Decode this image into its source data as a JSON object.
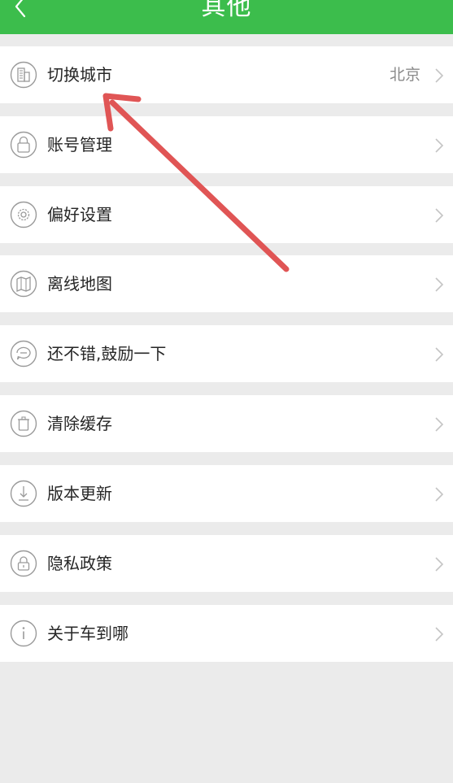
{
  "header": {
    "title": "其他",
    "background": "#3cbd4c",
    "back_icon": "chevron-left-icon"
  },
  "menu": {
    "items": [
      {
        "label": "切换城市",
        "value": "北京",
        "icon": "city-building-icon"
      },
      {
        "label": "账号管理",
        "value": "",
        "icon": "lock-icon"
      },
      {
        "label": "偏好设置",
        "value": "",
        "icon": "gear-icon"
      },
      {
        "label": "离线地图",
        "value": "",
        "icon": "map-download-icon"
      },
      {
        "label": "还不错,鼓励一下",
        "value": "",
        "icon": "chat-bubble-icon"
      },
      {
        "label": "清除缓存",
        "value": "",
        "icon": "trash-icon"
      },
      {
        "label": "版本更新",
        "value": "",
        "icon": "download-icon"
      },
      {
        "label": "隐私政策",
        "value": "",
        "icon": "privacy-lock-icon"
      },
      {
        "label": "关于车到哪",
        "value": "",
        "icon": "info-icon"
      }
    ]
  },
  "annotation": {
    "color": "#e05555",
    "type": "red-arrow"
  }
}
